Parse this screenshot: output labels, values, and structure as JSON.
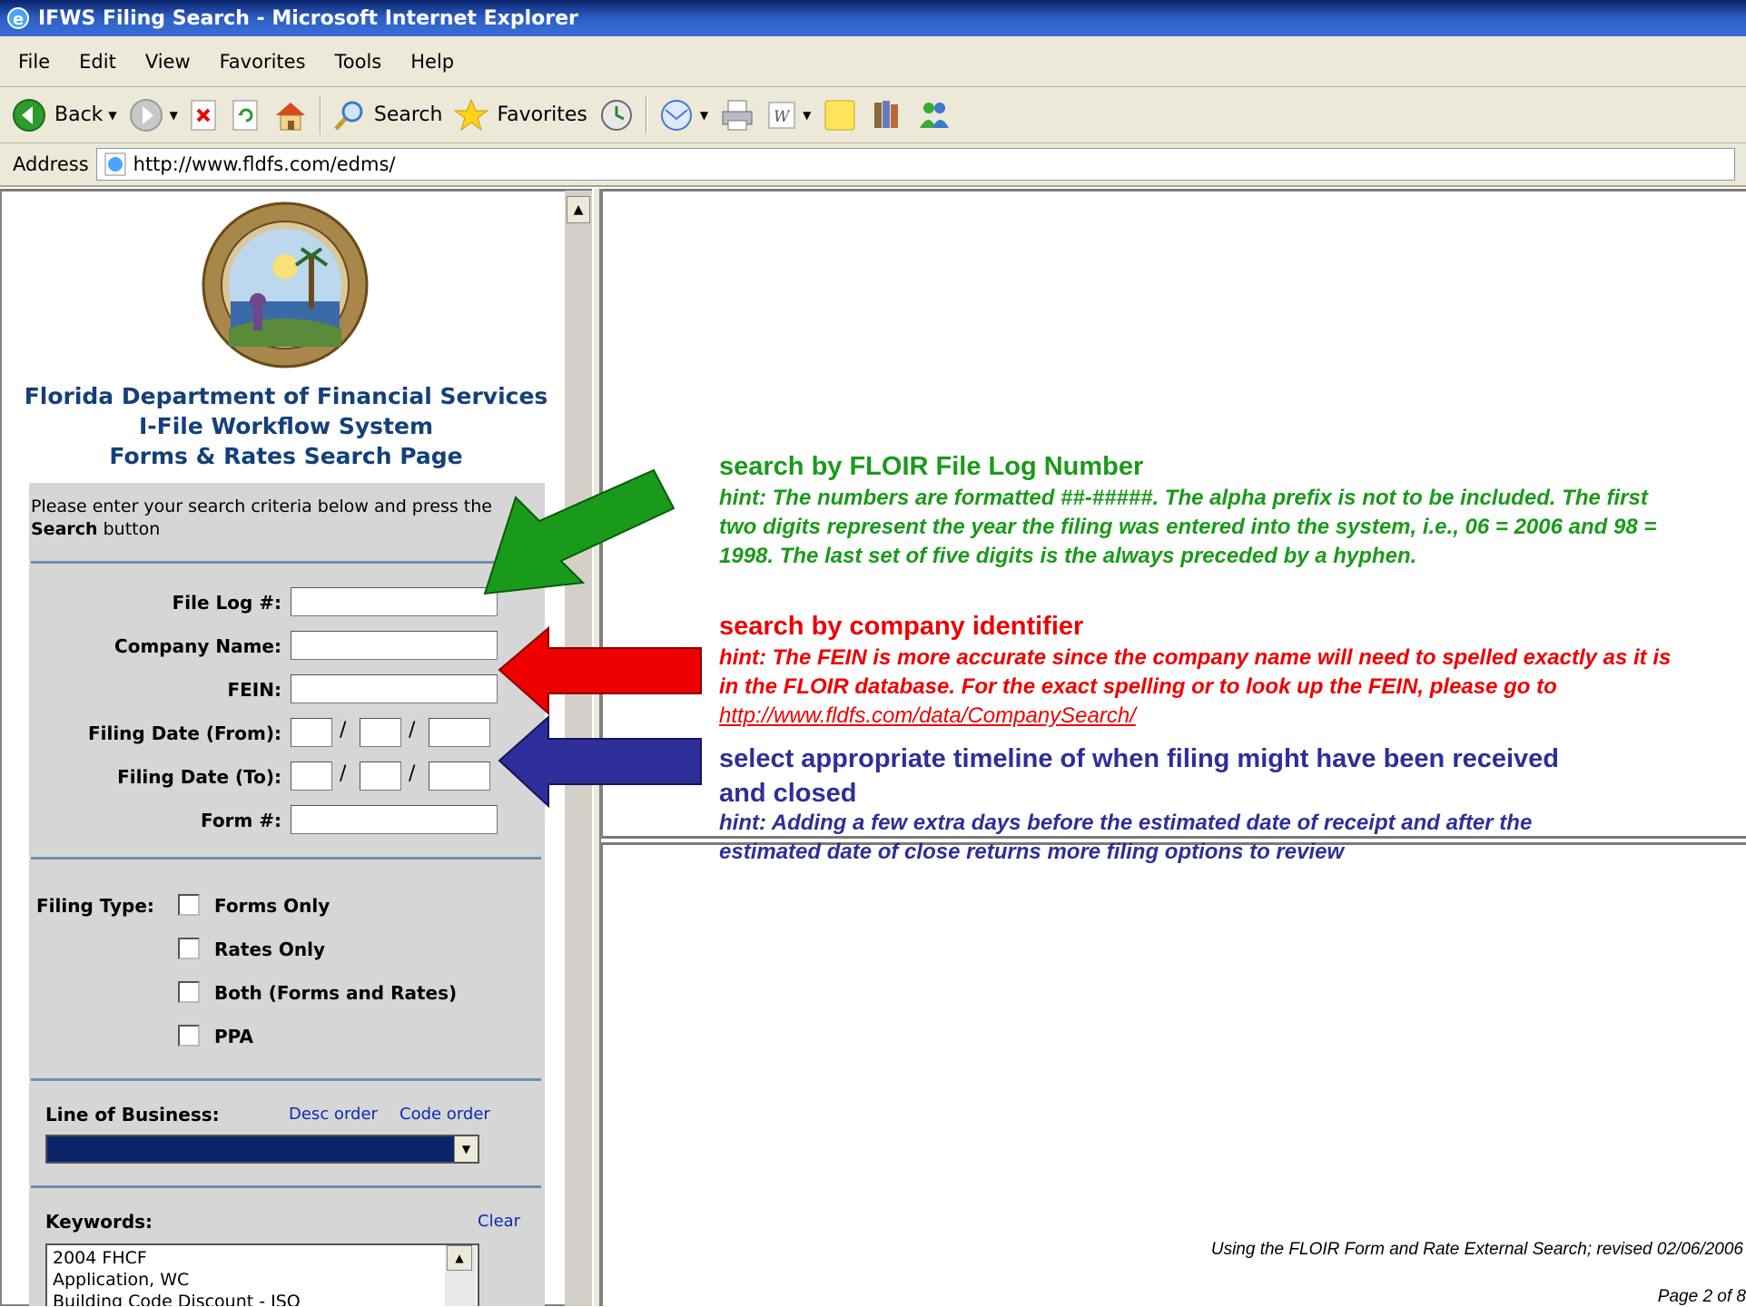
{
  "window": {
    "title": "IFWS Filing Search - Microsoft Internet Explorer"
  },
  "menu": {
    "items": [
      "File",
      "Edit",
      "View",
      "Favorites",
      "Tools",
      "Help"
    ]
  },
  "toolbar": {
    "back_label": "Back",
    "search_label": "Search",
    "favorites_label": "Favorites"
  },
  "address": {
    "label": "Address",
    "url": "http://www.fldfs.com/edms/"
  },
  "page": {
    "org_title_line1": "Florida Department of Financial Services",
    "org_title_line2": "I-File Workflow System",
    "org_title_line3": "Forms & Rates Search Page",
    "intro_text_pre": "Please enter your search criteria below and press the ",
    "intro_text_bold": "Search",
    "intro_text_post": " button"
  },
  "form": {
    "file_log_label": "File Log #:",
    "company_name_label": "Company Name:",
    "fein_label": "FEIN:",
    "filing_date_from_label": "Filing Date (From):",
    "filing_date_to_label": "Filing Date (To):",
    "form_number_label": "Form #:",
    "date_separator": "/",
    "filing_type_label": "Filing Type:",
    "filing_type_options": [
      "Forms Only",
      "Rates Only",
      "Both (Forms and Rates)",
      "PPA"
    ],
    "line_of_business_label": "Line of Business:",
    "desc_order_link": "Desc order",
    "code_order_link": "Code order",
    "keywords_label": "Keywords:",
    "clear_link": "Clear",
    "keywords_options": [
      "2004 FHCF",
      "Application, WC",
      "Building Code Discount - ISO"
    ]
  },
  "annotations": {
    "file_log": {
      "heading": "search by FLOIR File Log Number",
      "hint": "hint: The numbers are formatted ##-#####. The alpha prefix is not to be included. The first two digits represent the year the filing was entered into the system, i.e., 06 = 2006 and 98 = 1998. The last set of five digits is the always preceded by a hyphen."
    },
    "company": {
      "heading": "search by company identifier",
      "hint": "hint: The FEIN is more accurate since the company name will need to spelled exactly as it is in the FLOIR database.  For the exact spelling or to look up the FEIN, please go to ",
      "link": "http://www.fldfs.com/data/CompanySearch/"
    },
    "timeline": {
      "heading": "select appropriate timeline of when filing might have been received and closed",
      "hint": "hint: Adding a few extra days before the estimated date of receipt and after the estimated date of close returns more filing options to review"
    }
  },
  "footer": {
    "note": "Using the FLOIR Form and Rate External Search; revised 02/06/2006",
    "page": "Page 2 of 8"
  },
  "colors": {
    "title_bar": "#0a246a",
    "chrome": "#ece9d8",
    "panel": "#d6d6d6",
    "org_title": "#14407a",
    "green_annotation": "#1a9a1a",
    "red_annotation": "#ee0000",
    "blue_annotation": "#2e2e9a"
  },
  "icons": [
    "ie-icon",
    "back-icon",
    "forward-icon",
    "stop-icon",
    "refresh-icon",
    "home-icon",
    "search-icon",
    "favorites-star-icon",
    "history-icon",
    "mail-icon",
    "print-icon",
    "word-icon",
    "notes-icon",
    "research-icon",
    "messenger-icon",
    "page-icon",
    "florida-seal"
  ]
}
